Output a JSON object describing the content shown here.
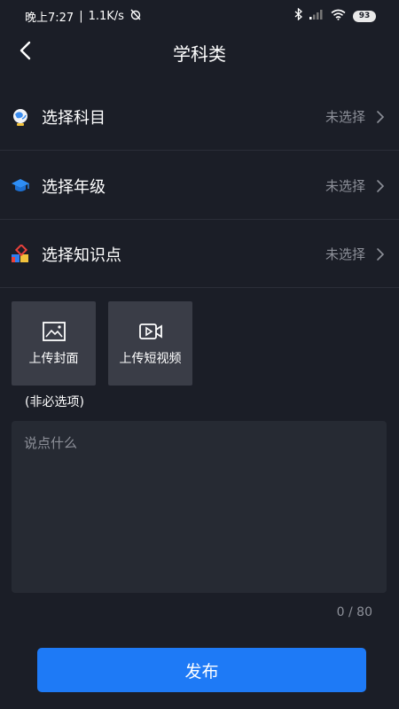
{
  "status_bar": {
    "time": "晚上7:27",
    "network_speed": "1.1K/s",
    "battery": "93",
    "icons": [
      "alarm-off-icon",
      "bluetooth-icon",
      "signal-icon",
      "wifi-icon",
      "battery-icon"
    ]
  },
  "header": {
    "title": "学科类",
    "back_icon": "back-arrow-icon"
  },
  "rows": [
    {
      "label": "选择科目",
      "value": "未选择",
      "icon": "globe-icon"
    },
    {
      "label": "选择年级",
      "value": "未选择",
      "icon": "graduation-cap-icon"
    },
    {
      "label": "选择知识点",
      "value": "未选择",
      "icon": "colorful-blocks-icon"
    }
  ],
  "uploads": {
    "cover_label": "上传封面",
    "video_label": "上传短视频",
    "optional_note": "(非必选项)"
  },
  "text_input": {
    "placeholder": "说点什么",
    "counter": "0 / 80"
  },
  "publish": {
    "label": "发布"
  },
  "colors": {
    "background": "#1b1e27",
    "tile": "#3a3d47",
    "accent": "#1e7af6",
    "muted_text": "#8d9099"
  }
}
